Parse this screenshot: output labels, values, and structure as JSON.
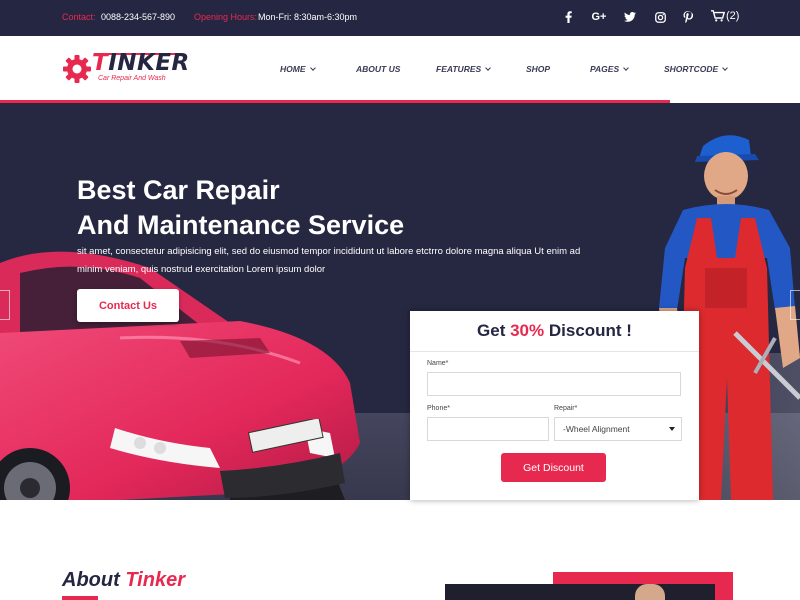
{
  "topbar": {
    "contact_label": "Contact:",
    "contact_value": "0088-234-567-890",
    "hours_label": "Opening Hours:",
    "hours_value": "Mon-Fri: 8:30am-6:30pm",
    "social": [
      "facebook-icon",
      "google-plus-icon",
      "twitter-icon",
      "instagram-icon",
      "pinterest-icon"
    ],
    "google_plus_text": "G+",
    "cart_count": "(2)"
  },
  "header": {
    "logo_letter": "T",
    "logo_rest": "INKER",
    "logo_tagline": "Car Repair And Wash",
    "nav": [
      {
        "label": "HOME",
        "dropdown": true
      },
      {
        "label": "ABOUT US",
        "dropdown": false
      },
      {
        "label": "FEATURES",
        "dropdown": true
      },
      {
        "label": "SHOP",
        "dropdown": false
      },
      {
        "label": "PAGES",
        "dropdown": true
      },
      {
        "label": "SHORTCODE",
        "dropdown": true
      }
    ]
  },
  "hero": {
    "title_line1": "Best Car Repair",
    "title_line2": "And Maintenance Service",
    "description": "sit amet, consectetur adipisicing elit, sed do eiusmod tempor incididunt ut labore etctrro dolore magna aliqua Ut enim ad minim veniam, quis nostrud exercitation Lorem ipsum dolor",
    "cta_label": "Contact Us"
  },
  "discount_form": {
    "title_prefix": "Get",
    "title_percent": "30%",
    "title_suffix": "Discount !",
    "name_label": "Name*",
    "name_value": "",
    "phone_label": "Phone*",
    "phone_value": "",
    "repair_label": "Repair*",
    "repair_selected": "-Wheel Alignment",
    "submit_label": "Get Discount"
  },
  "about": {
    "title_prefix": "About",
    "title_accent": "Tinker"
  },
  "colors": {
    "accent": "#e8294f",
    "dark": "#252642"
  }
}
